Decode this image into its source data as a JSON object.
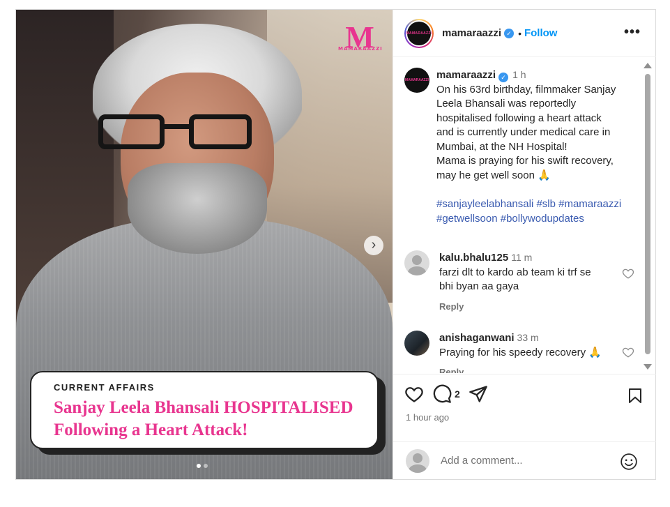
{
  "post": {
    "brand_logo_text": "MAMARAAZZI",
    "kicker": "CURRENT AFFAIRS",
    "headline": "Sanjay Leela Bhansali HOSPITALISED Following a Heart Attack!",
    "headline_line1": "Sanjay Leela Bhansali HOSPITALISED",
    "headline_line2": "Following a Heart Attack!",
    "carousel_dots": 2,
    "active_dot": 0
  },
  "header": {
    "username": "mamaraazzi",
    "separator": "•",
    "follow_label": "Follow",
    "more_icon": "more-horizontal-icon"
  },
  "caption": {
    "username": "mamaraazzi",
    "time": "1 h",
    "lines": [
      "On his 63rd birthday, filmmaker Sanjay",
      "Leela Bhansali was reportedly",
      "hospitalised following a heart attack",
      "and is currently under medical care in",
      "Mumbai, at the NH Hospital!",
      "Mama is praying for his swift recovery,",
      "may he get well soon 🙏"
    ],
    "hashtags_line1": "#sanjayleelabhansali #slb #mamaraazzi",
    "hashtags_line2": "#getwellsoon #bollywodupdates"
  },
  "comments": [
    {
      "username": "kalu.bhalu125",
      "time": "11 m",
      "text_line1": "farzi dlt to kardo ab team ki trf se",
      "text_line2": "bhi byan aa gaya",
      "reply_label": "Reply"
    },
    {
      "username": "anishaganwani",
      "time": "33 m",
      "text_line1": "Praying for his speedy recovery 🙏",
      "reply_label": "Reply"
    }
  ],
  "actions": {
    "comment_count": "2",
    "posted_ago": "1 hour ago"
  },
  "add_comment": {
    "placeholder": "Add a comment..."
  },
  "colors": {
    "brand_pink": "#e8358f",
    "link_blue": "#0095f6",
    "hashtag_blue": "#3a5bb0",
    "muted": "#737373"
  }
}
